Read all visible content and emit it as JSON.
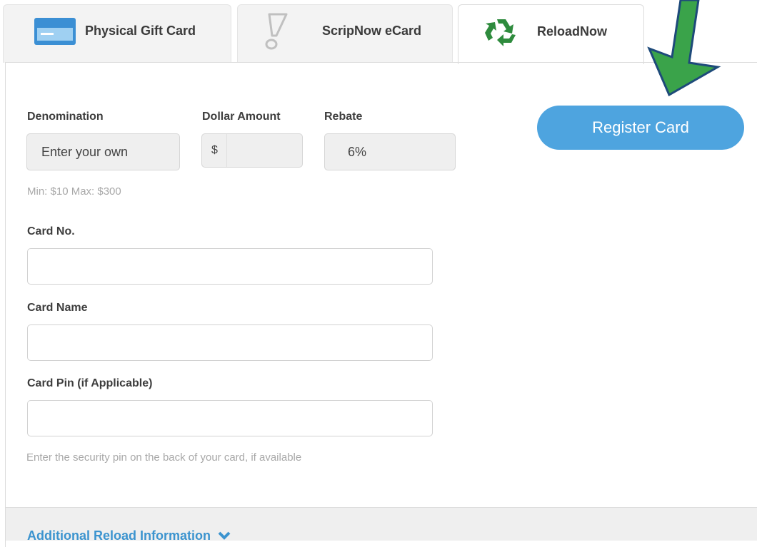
{
  "tabs": [
    {
      "label": "Physical Gift Card",
      "icon": "credit-card-icon",
      "active": false
    },
    {
      "label": "ScripNow eCard",
      "icon": "lightning-icon",
      "active": false
    },
    {
      "label": "ReloadNow",
      "icon": "recycle-icon",
      "active": true
    }
  ],
  "form": {
    "denomination": {
      "label": "Denomination",
      "value": "Enter your own"
    },
    "dollar_amount": {
      "label": "Dollar Amount",
      "prefix": "$",
      "value": ""
    },
    "rebate": {
      "label": "Rebate",
      "value": "6%"
    },
    "range_hint": "Min: $10 Max: $300",
    "card_no": {
      "label": "Card No.",
      "value": ""
    },
    "card_name": {
      "label": "Card Name",
      "value": ""
    },
    "card_pin": {
      "label": "Card Pin (if Applicable)",
      "value": "",
      "hint": "Enter the security pin on the back of your card, if available"
    }
  },
  "register_button": {
    "label": "Register Card"
  },
  "footer": {
    "link": "Additional Reload Information"
  },
  "colors": {
    "accent_blue": "#4ea4df",
    "link_blue": "#3c94cf",
    "arrow_green": "#3aa34a",
    "recycle_green": "#2e8b3d"
  }
}
